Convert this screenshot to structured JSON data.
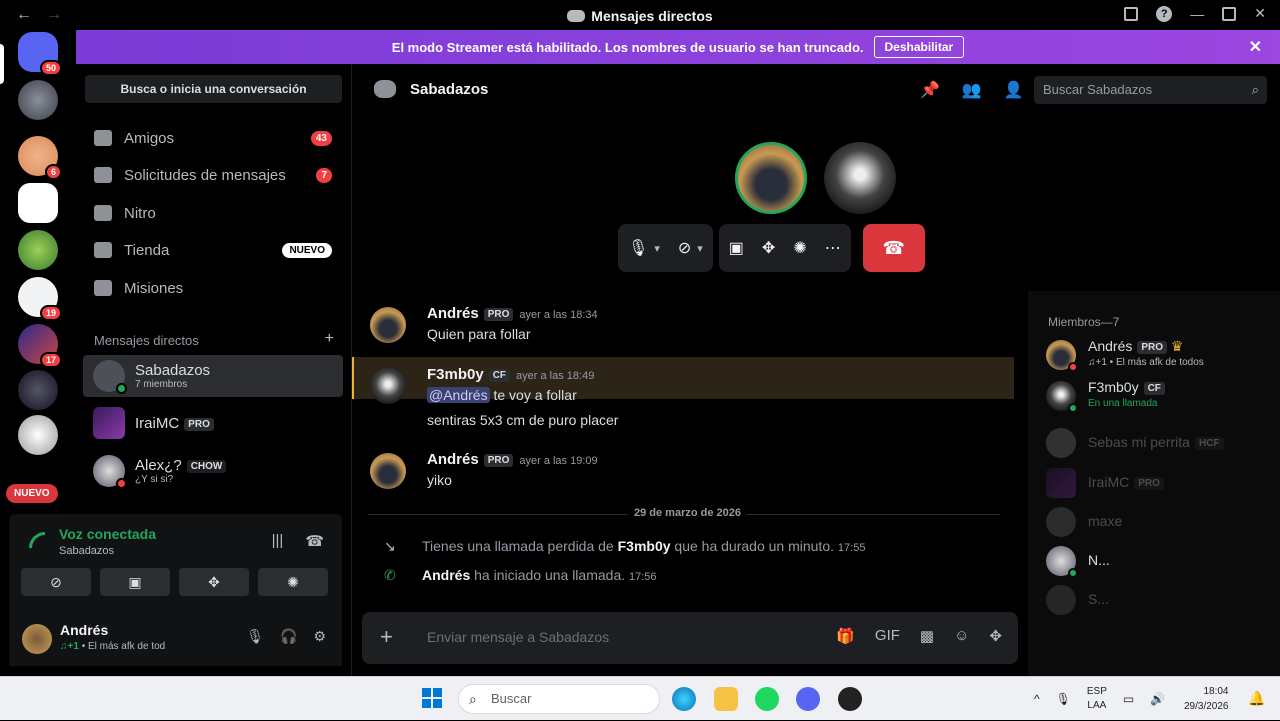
{
  "window": {
    "title": "Mensajes directos",
    "back": "←",
    "forward": "→",
    "min": "—",
    "close": "✕"
  },
  "rail": {
    "discord_badge": "50",
    "srv1_badge": "6",
    "srv2_badge": "19",
    "srv3_badge": "17",
    "nuevo": "NUEVO"
  },
  "banner": {
    "text": "El modo Streamer está habilitado. Los nombres de usuario se han truncado.",
    "button": "Deshabilitar",
    "close": "✕"
  },
  "sidebar": {
    "search": "Busca o inicia una conversación",
    "nav": [
      {
        "label": "Amigos",
        "count": "43"
      },
      {
        "label": "Solicitudes de mensajes",
        "count": "7"
      },
      {
        "label": "Nitro"
      },
      {
        "label": "Tienda",
        "badge": "NUEVO"
      },
      {
        "label": "Misiones"
      }
    ],
    "dm_header": "Mensajes directos",
    "dm_add": "+",
    "dms": [
      {
        "name": "Sabadazos",
        "sub": "7 miembros"
      },
      {
        "name": "IraiMC",
        "tag": "PRO"
      },
      {
        "name": "Alex¿?",
        "sub": "¿Y si si?",
        "tag": "CHOW"
      }
    ]
  },
  "voice": {
    "status": "Voz conectada",
    "channel": "Sabadazos"
  },
  "user": {
    "name": "Andrés",
    "activity_prefix": "♫+1",
    "activity": "• El más afk de tod"
  },
  "channel": {
    "name": "Sabadazos",
    "search_placeholder": "Buscar Sabadazos"
  },
  "messages": [
    {
      "author": "Andrés",
      "tag": "PRO",
      "time": "ayer a las 18:34",
      "lines": [
        "Quien para follar"
      ]
    },
    {
      "author": "F3mb0y",
      "tag": "CF",
      "time": "ayer a las 18:49",
      "mention": "@Andrés",
      "lines": [
        "te voy a follar",
        "sentiras 5x3 cm de puro placer"
      ]
    },
    {
      "author": "Andrés",
      "tag": "PRO",
      "time": "ayer a las 19:09",
      "lines": [
        "yiko"
      ]
    }
  ],
  "date_divider": "29 de marzo de 2026",
  "system": [
    {
      "pre": "Tienes una llamada perdida de ",
      "user": "F3mb0y",
      "post": " que ha durado un minuto.",
      "time": "17:55"
    },
    {
      "user": "Andrés",
      "post": " ha iniciado una llamada.",
      "time": "17:56"
    }
  ],
  "composer": {
    "placeholder": "Enviar mensaje a Sabadazos"
  },
  "members": {
    "header": "Miembros—7",
    "list": [
      {
        "name": "Andrés",
        "tag": "PRO",
        "sub": "♫+1 • El más afk de todos"
      },
      {
        "name": "F3mb0y",
        "tag": "CF",
        "sub": "En una llamada"
      },
      {
        "name": "Sebas mi perrita",
        "tag": "HCF"
      },
      {
        "name": "IraiMC",
        "tag": "PRO"
      },
      {
        "name": "maxe"
      },
      {
        "name": "N..."
      },
      {
        "name": "S..."
      }
    ]
  },
  "taskbar": {
    "search": "Buscar",
    "lang1": "ESP",
    "lang2": "LAA",
    "time": "18:04",
    "date": "29/3/2026"
  },
  "colors": {
    "accent": "#5865f2",
    "banner": "#9b47e0",
    "online": "#23a55a",
    "danger": "#da373c"
  }
}
